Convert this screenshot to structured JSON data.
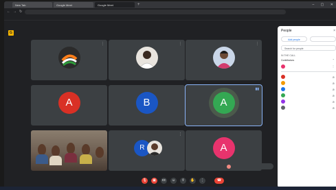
{
  "browser": {
    "tabs": [
      "New Tab",
      "Google Meet",
      "Google Meet",
      ""
    ],
    "url": "",
    "bookmarks": ""
  },
  "meet": {
    "logo_letter": "G",
    "tiles": [
      {
        "name": "",
        "type": "photo"
      },
      {
        "name": "",
        "type": "photo"
      },
      {
        "name": "",
        "type": "photo"
      },
      {
        "name": "",
        "initial": "A",
        "color": "#d93025"
      },
      {
        "name": "",
        "initial": "B",
        "color": "#1a56c4"
      },
      {
        "name": "",
        "initial": "A",
        "color": "#34a853"
      },
      {
        "name": "",
        "type": "video"
      },
      {
        "name": "",
        "initial": "R",
        "color": "#1a56c4"
      },
      {
        "name": "",
        "initial": "A",
        "color": "#e8336d"
      }
    ],
    "presenter_chip": "",
    "bottom_left": "",
    "end_call_icon": "phone-hangup-icon"
  },
  "panel": {
    "title": "People",
    "close": "×",
    "add_people": "Add people",
    "host_controls": "",
    "search_placeholder": "Search for people",
    "in_call_section": "IN THE CALL",
    "contributors": "Contributors",
    "participants": [
      {
        "name": "",
        "color": "#e8336d"
      },
      {
        "name": "",
        "color": "#d93025"
      },
      {
        "name": "",
        "color": "#f29900"
      },
      {
        "name": "",
        "color": "#1a73e8"
      },
      {
        "name": "",
        "color": "#34a853"
      },
      {
        "name": "",
        "color": "#9334e6"
      },
      {
        "name": "",
        "color": "#5f6368"
      }
    ]
  }
}
